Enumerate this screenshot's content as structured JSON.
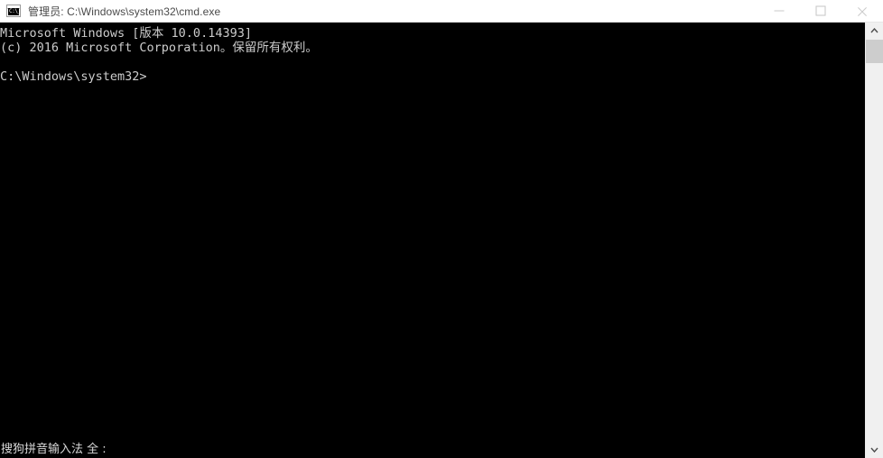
{
  "window": {
    "title": "管理员: C:\\Windows\\system32\\cmd.exe",
    "icon_name": "cmd-console-icon",
    "icon_text": "C:\\_",
    "background_color": "#000000",
    "titlebar_color": "#ffffff",
    "title_text_color": "#4a4a4a"
  },
  "controls": {
    "minimize_label": "最小化",
    "maximize_label": "最大化",
    "close_label": "关闭"
  },
  "console": {
    "foreground_color": "#cccccc",
    "background_color": "#000000",
    "lines": [
      "Microsoft Windows [版本 10.0.14393]",
      "(c) 2016 Microsoft Corporation。保留所有权利。",
      "",
      "C:\\Windows\\system32>"
    ],
    "text": "Microsoft Windows [版本 10.0.14393]\n(c) 2016 Microsoft Corporation。保留所有权利。\n\nC:\\Windows\\system32>",
    "product_name": "Microsoft Windows",
    "version": "10.0.14393",
    "copyright_year": "2016",
    "copyright_holder": "Microsoft Corporation",
    "rights_text": "保留所有权利。",
    "prompt": "C:\\Windows\\system32>",
    "current_directory": "C:\\Windows\\system32"
  },
  "ime": {
    "status_text": "搜狗拼音输入法 全 :",
    "name": "搜狗拼音输入法",
    "mode": "全",
    "separator": ":"
  },
  "scrollbar": {
    "up_arrow": "▲",
    "down_arrow": "▼",
    "thumb_color": "#cdcdcd",
    "track_color": "#f0f0f0"
  }
}
